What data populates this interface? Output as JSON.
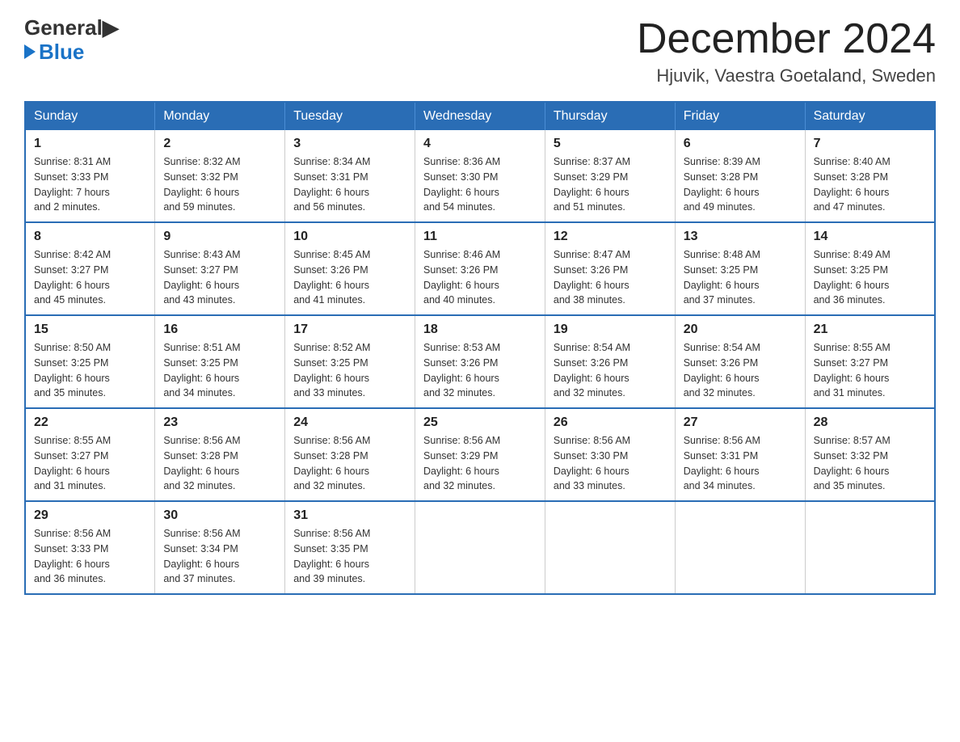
{
  "header": {
    "logo": {
      "general": "General",
      "blue": "Blue",
      "triangle": "▶"
    },
    "month": "December 2024",
    "location": "Hjuvik, Vaestra Goetaland, Sweden"
  },
  "weekdays": [
    "Sunday",
    "Monday",
    "Tuesday",
    "Wednesday",
    "Thursday",
    "Friday",
    "Saturday"
  ],
  "weeks": [
    [
      {
        "day": "1",
        "sunrise": "8:31 AM",
        "sunset": "3:33 PM",
        "daylight": "7 hours",
        "daylight2": "and 2 minutes."
      },
      {
        "day": "2",
        "sunrise": "8:32 AM",
        "sunset": "3:32 PM",
        "daylight": "6 hours",
        "daylight2": "and 59 minutes."
      },
      {
        "day": "3",
        "sunrise": "8:34 AM",
        "sunset": "3:31 PM",
        "daylight": "6 hours",
        "daylight2": "and 56 minutes."
      },
      {
        "day": "4",
        "sunrise": "8:36 AM",
        "sunset": "3:30 PM",
        "daylight": "6 hours",
        "daylight2": "and 54 minutes."
      },
      {
        "day": "5",
        "sunrise": "8:37 AM",
        "sunset": "3:29 PM",
        "daylight": "6 hours",
        "daylight2": "and 51 minutes."
      },
      {
        "day": "6",
        "sunrise": "8:39 AM",
        "sunset": "3:28 PM",
        "daylight": "6 hours",
        "daylight2": "and 49 minutes."
      },
      {
        "day": "7",
        "sunrise": "8:40 AM",
        "sunset": "3:28 PM",
        "daylight": "6 hours",
        "daylight2": "and 47 minutes."
      }
    ],
    [
      {
        "day": "8",
        "sunrise": "8:42 AM",
        "sunset": "3:27 PM",
        "daylight": "6 hours",
        "daylight2": "and 45 minutes."
      },
      {
        "day": "9",
        "sunrise": "8:43 AM",
        "sunset": "3:27 PM",
        "daylight": "6 hours",
        "daylight2": "and 43 minutes."
      },
      {
        "day": "10",
        "sunrise": "8:45 AM",
        "sunset": "3:26 PM",
        "daylight": "6 hours",
        "daylight2": "and 41 minutes."
      },
      {
        "day": "11",
        "sunrise": "8:46 AM",
        "sunset": "3:26 PM",
        "daylight": "6 hours",
        "daylight2": "and 40 minutes."
      },
      {
        "day": "12",
        "sunrise": "8:47 AM",
        "sunset": "3:26 PM",
        "daylight": "6 hours",
        "daylight2": "and 38 minutes."
      },
      {
        "day": "13",
        "sunrise": "8:48 AM",
        "sunset": "3:25 PM",
        "daylight": "6 hours",
        "daylight2": "and 37 minutes."
      },
      {
        "day": "14",
        "sunrise": "8:49 AM",
        "sunset": "3:25 PM",
        "daylight": "6 hours",
        "daylight2": "and 36 minutes."
      }
    ],
    [
      {
        "day": "15",
        "sunrise": "8:50 AM",
        "sunset": "3:25 PM",
        "daylight": "6 hours",
        "daylight2": "and 35 minutes."
      },
      {
        "day": "16",
        "sunrise": "8:51 AM",
        "sunset": "3:25 PM",
        "daylight": "6 hours",
        "daylight2": "and 34 minutes."
      },
      {
        "day": "17",
        "sunrise": "8:52 AM",
        "sunset": "3:25 PM",
        "daylight": "6 hours",
        "daylight2": "and 33 minutes."
      },
      {
        "day": "18",
        "sunrise": "8:53 AM",
        "sunset": "3:26 PM",
        "daylight": "6 hours",
        "daylight2": "and 32 minutes."
      },
      {
        "day": "19",
        "sunrise": "8:54 AM",
        "sunset": "3:26 PM",
        "daylight": "6 hours",
        "daylight2": "and 32 minutes."
      },
      {
        "day": "20",
        "sunrise": "8:54 AM",
        "sunset": "3:26 PM",
        "daylight": "6 hours",
        "daylight2": "and 32 minutes."
      },
      {
        "day": "21",
        "sunrise": "8:55 AM",
        "sunset": "3:27 PM",
        "daylight": "6 hours",
        "daylight2": "and 31 minutes."
      }
    ],
    [
      {
        "day": "22",
        "sunrise": "8:55 AM",
        "sunset": "3:27 PM",
        "daylight": "6 hours",
        "daylight2": "and 31 minutes."
      },
      {
        "day": "23",
        "sunrise": "8:56 AM",
        "sunset": "3:28 PM",
        "daylight": "6 hours",
        "daylight2": "and 32 minutes."
      },
      {
        "day": "24",
        "sunrise": "8:56 AM",
        "sunset": "3:28 PM",
        "daylight": "6 hours",
        "daylight2": "and 32 minutes."
      },
      {
        "day": "25",
        "sunrise": "8:56 AM",
        "sunset": "3:29 PM",
        "daylight": "6 hours",
        "daylight2": "and 32 minutes."
      },
      {
        "day": "26",
        "sunrise": "8:56 AM",
        "sunset": "3:30 PM",
        "daylight": "6 hours",
        "daylight2": "and 33 minutes."
      },
      {
        "day": "27",
        "sunrise": "8:56 AM",
        "sunset": "3:31 PM",
        "daylight": "6 hours",
        "daylight2": "and 34 minutes."
      },
      {
        "day": "28",
        "sunrise": "8:57 AM",
        "sunset": "3:32 PM",
        "daylight": "6 hours",
        "daylight2": "and 35 minutes."
      }
    ],
    [
      {
        "day": "29",
        "sunrise": "8:56 AM",
        "sunset": "3:33 PM",
        "daylight": "6 hours",
        "daylight2": "and 36 minutes."
      },
      {
        "day": "30",
        "sunrise": "8:56 AM",
        "sunset": "3:34 PM",
        "daylight": "6 hours",
        "daylight2": "and 37 minutes."
      },
      {
        "day": "31",
        "sunrise": "8:56 AM",
        "sunset": "3:35 PM",
        "daylight": "6 hours",
        "daylight2": "and 39 minutes."
      },
      null,
      null,
      null,
      null
    ]
  ]
}
